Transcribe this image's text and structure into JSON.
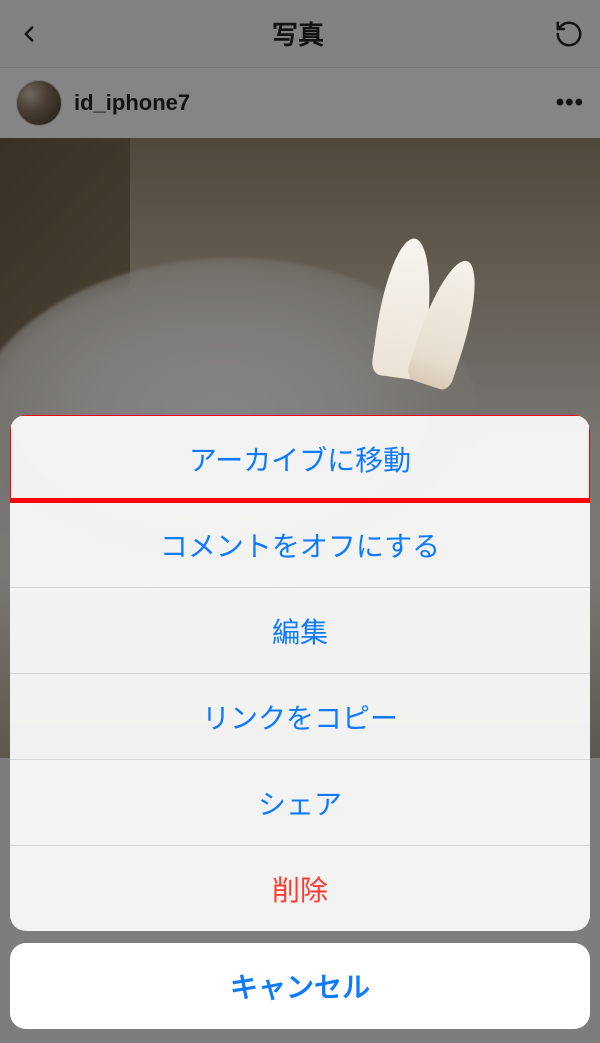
{
  "header": {
    "title": "写真"
  },
  "user": {
    "name": "id_iphone7"
  },
  "action_sheet": {
    "items": [
      {
        "label": "アーカイブに移動",
        "destructive": false
      },
      {
        "label": "コメントをオフにする",
        "destructive": false
      },
      {
        "label": "編集",
        "destructive": false
      },
      {
        "label": "リンクをコピー",
        "destructive": false
      },
      {
        "label": "シェア",
        "destructive": false
      },
      {
        "label": "削除",
        "destructive": true
      }
    ],
    "cancel": "キャンセル"
  }
}
